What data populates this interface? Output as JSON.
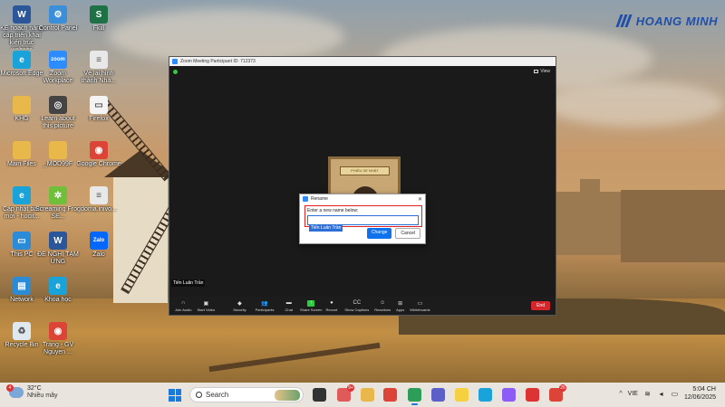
{
  "brand": {
    "name": "HOANG MINH"
  },
  "desktop_icons": [
    {
      "label": "KẾ hoạch nâng cấp triển khai kiến trúc website Nada.vn.doc",
      "icon": "word-doc-icon",
      "color": "#2b579a",
      "glyph": "W"
    },
    {
      "label": "Control Panel",
      "icon": "control-panel-icon",
      "color": "#3a8fd8",
      "glyph": "⚙"
    },
    {
      "label": "Fkill",
      "icon": "excel-icon",
      "color": "#1e7145",
      "glyph": "S"
    },
    {
      "label": "Microsoft Edge",
      "icon": "edge-icon",
      "color": "#1aa3d8",
      "glyph": "e"
    },
    {
      "label": "Zoom Workplace",
      "icon": "zoom-icon",
      "color": "#2d8cff",
      "glyph": "zoom"
    },
    {
      "label": "Về lại hình thành Nhà...",
      "icon": "text-file-icon",
      "color": "#e8e8e8",
      "glyph": "≡"
    },
    {
      "label": "KHG",
      "icon": "folder-icon",
      "color": "#e8b84a",
      "glyph": ""
    },
    {
      "label": "Learn about this picture",
      "icon": "camera-icon",
      "color": "#444",
      "glyph": "◎"
    },
    {
      "label": "Firefox",
      "icon": "window-icon",
      "color": "#f4f4f4",
      "glyph": "▭"
    },
    {
      "label": "Main Files",
      "icon": "folder-icon",
      "color": "#e8b84a",
      "glyph": ""
    },
    {
      "label": "_MOD99F",
      "icon": "folder-icon",
      "color": "#e8b84a",
      "glyph": ""
    },
    {
      "label": "Google Chrome",
      "icon": "chrome-icon",
      "color": "#db4437",
      "glyph": "◉"
    },
    {
      "label": "Cập nhật bản mới - hocit...",
      "icon": "edge-icon",
      "color": "#1aa3d8",
      "glyph": "e"
    },
    {
      "label": "Screaming Frog SE...",
      "icon": "frog-icon",
      "color": "#6fbf3a",
      "glyph": "✲"
    },
    {
      "label": "doma.inivo...",
      "icon": "text-file-icon",
      "color": "#e8e8e8",
      "glyph": "≡"
    },
    {
      "label": "This PC",
      "icon": "monitor-icon",
      "color": "#2c8bd6",
      "glyph": "▭"
    },
    {
      "label": "ĐỀ NGHỊ TẠM ỨNG",
      "icon": "word-doc-icon",
      "color": "#2b579a",
      "glyph": "W"
    },
    {
      "label": "Zalo",
      "icon": "zalo-icon",
      "color": "#0068ff",
      "glyph": "Zalo"
    },
    {
      "label": "Network",
      "icon": "network-icon",
      "color": "#2c8bd6",
      "glyph": "▤"
    },
    {
      "label": "Khoa học",
      "icon": "edge-icon",
      "color": "#1aa3d8",
      "glyph": "e"
    },
    {
      "label": "Recycle Bin",
      "icon": "recycle-bin-icon",
      "color": "#dfe8ef",
      "glyph": "♻"
    },
    {
      "label": "Trang - GV Nguyen ...",
      "icon": "chrome-icon",
      "color": "#db4437",
      "glyph": "◉"
    }
  ],
  "zoom": {
    "window_title": "Zoom Meeting Participant ID: 712373",
    "view_label": "View",
    "participant_label": "Tiến Luân Trần",
    "frame_text": "PHIẾU XE NHẬT",
    "toolbar": [
      {
        "label": "Join Audio",
        "icon": "headphone-icon",
        "glyph": "∩"
      },
      {
        "label": "Start Video",
        "icon": "video-off-icon",
        "glyph": "▣"
      },
      {
        "label": "Security",
        "icon": "shield-icon",
        "glyph": "◆"
      },
      {
        "label": "Participants",
        "icon": "participants-icon",
        "glyph": "👥"
      },
      {
        "label": "Chat",
        "icon": "chat-icon",
        "glyph": "▬"
      },
      {
        "label": "Share Screen",
        "icon": "share-screen-icon",
        "glyph": "↑",
        "green": true
      },
      {
        "label": "Record",
        "icon": "record-icon",
        "glyph": "●"
      },
      {
        "label": "Show Captions",
        "icon": "captions-icon",
        "glyph": "CC"
      },
      {
        "label": "Reactions",
        "icon": "reactions-icon",
        "glyph": "☺"
      },
      {
        "label": "Apps",
        "icon": "apps-icon",
        "glyph": "⊞"
      },
      {
        "label": "Whiteboards",
        "icon": "whiteboard-icon",
        "glyph": "▭"
      }
    ],
    "end_label": "End"
  },
  "rename_dialog": {
    "title": "Rename",
    "prompt": "Enter a new name below:",
    "value": "Tiến Luân Trần",
    "change_label": "Change",
    "cancel_label": "Cancel"
  },
  "taskbar": {
    "weather_temp": "32°C",
    "weather_condition": "Nhiều mây",
    "weather_badge": "4",
    "search_label": "Search",
    "apps": [
      {
        "name": "taskview-icon",
        "color": "#333"
      },
      {
        "name": "news-icon",
        "color": "#e05a5a",
        "badge": "9+"
      },
      {
        "name": "file-explorer-icon",
        "color": "#e8b84a"
      },
      {
        "name": "chrome-icon",
        "color": "#db4437"
      },
      {
        "name": "chrome-profile-icon",
        "color": "#2d9d5a",
        "active": true
      },
      {
        "name": "teams-icon",
        "color": "#5b5fc7"
      },
      {
        "name": "sticky-notes-icon",
        "color": "#f5d142"
      },
      {
        "name": "edge-icon",
        "color": "#1aa3d8"
      },
      {
        "name": "copilot-icon",
        "color": "#8b5cf6"
      },
      {
        "name": "wps-icon",
        "color": "#d33"
      },
      {
        "name": "chrome-alt-icon",
        "color": "#db4437",
        "badge": "26"
      }
    ],
    "lang": "VIE",
    "time": "5:04 CH",
    "date": "12/06/2025"
  }
}
